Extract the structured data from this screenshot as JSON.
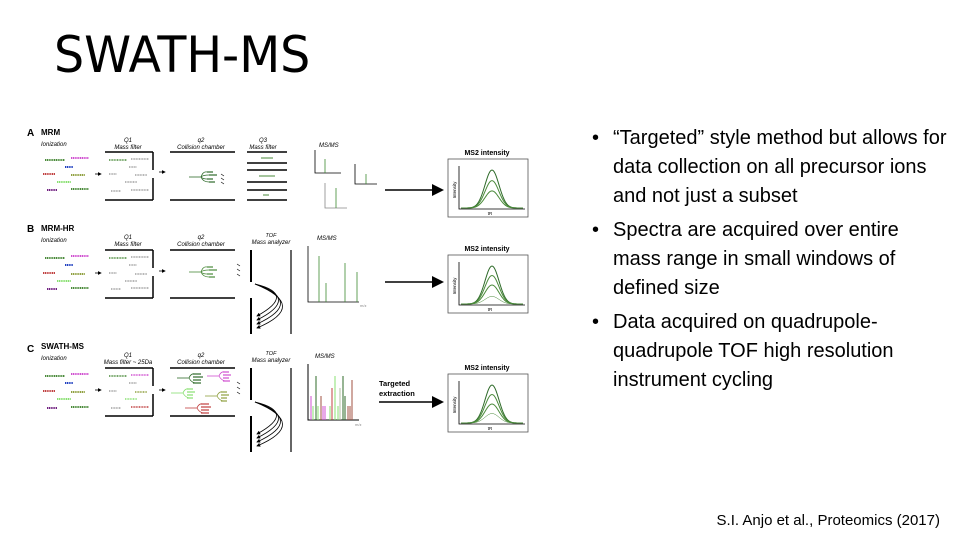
{
  "slide": {
    "title": "SWATH-MS",
    "bullets": [
      "“Targeted” style method but allows for data collection on all precursor ions and not just a subset",
      "Spectra are acquired over entire mass range in small windows of defined size",
      "Data acquired on quadrupole-quadrupole TOF high resolution instrument cycling"
    ],
    "bullet_glyph": "•",
    "citation": "S.I. Anjo et al., Proteomics (2017)"
  },
  "figure": {
    "panels": [
      {
        "letter": "A",
        "name": "MRM",
        "ionization": "Ionization",
        "q1_title": "Q1",
        "q1_sub": "Mass filter",
        "q2_title": "q2",
        "q2_sub": "Collision chamber",
        "q3_title": "Q3",
        "q3_sub": "Mass filter",
        "spectrum_label": "MS/MS",
        "result_title": "MS2 intensity",
        "y_label": "Intensity",
        "x_label": "tR",
        "arrow_label": ""
      },
      {
        "letter": "B",
        "name": "MRM-HR",
        "ionization": "Ionization",
        "q1_title": "Q1",
        "q1_sub": "Mass filter",
        "q2_title": "q2",
        "q2_sub": "Collision chamber",
        "q3_title": "TOF",
        "q3_sub": "Mass analyzer",
        "spectrum_label": "MS/MS",
        "result_title": "MS2 intensity",
        "y_label": "Intensity",
        "x_label": "tR",
        "arrow_label": ""
      },
      {
        "letter": "C",
        "name": "SWATH-MS",
        "ionization": "Ionization",
        "q1_title": "Q1",
        "q1_sub": "Mass filter ~ 25Da",
        "q2_title": "q2",
        "q2_sub": "Collision chamber",
        "q3_title": "TOF",
        "q3_sub": "Mass analyzer",
        "spectrum_label": "MS/MS",
        "result_title": "MS2 intensity",
        "y_label": "Intensity",
        "x_label": "tR",
        "arrow_label_1": "Targeted",
        "arrow_label_2": "extraction"
      }
    ],
    "mz_label": "m/z",
    "colors": {
      "green": "#4a8a3a",
      "dark_green": "#2f6b2a",
      "light_green": "#88e070",
      "magenta": "#d050d0",
      "blue": "#2040c0",
      "red": "#c04040",
      "olive": "#90a040",
      "purple": "#702080",
      "gray": "#a0a0a0",
      "brown": "#a05040",
      "peak_green": "#3c8a30"
    }
  }
}
